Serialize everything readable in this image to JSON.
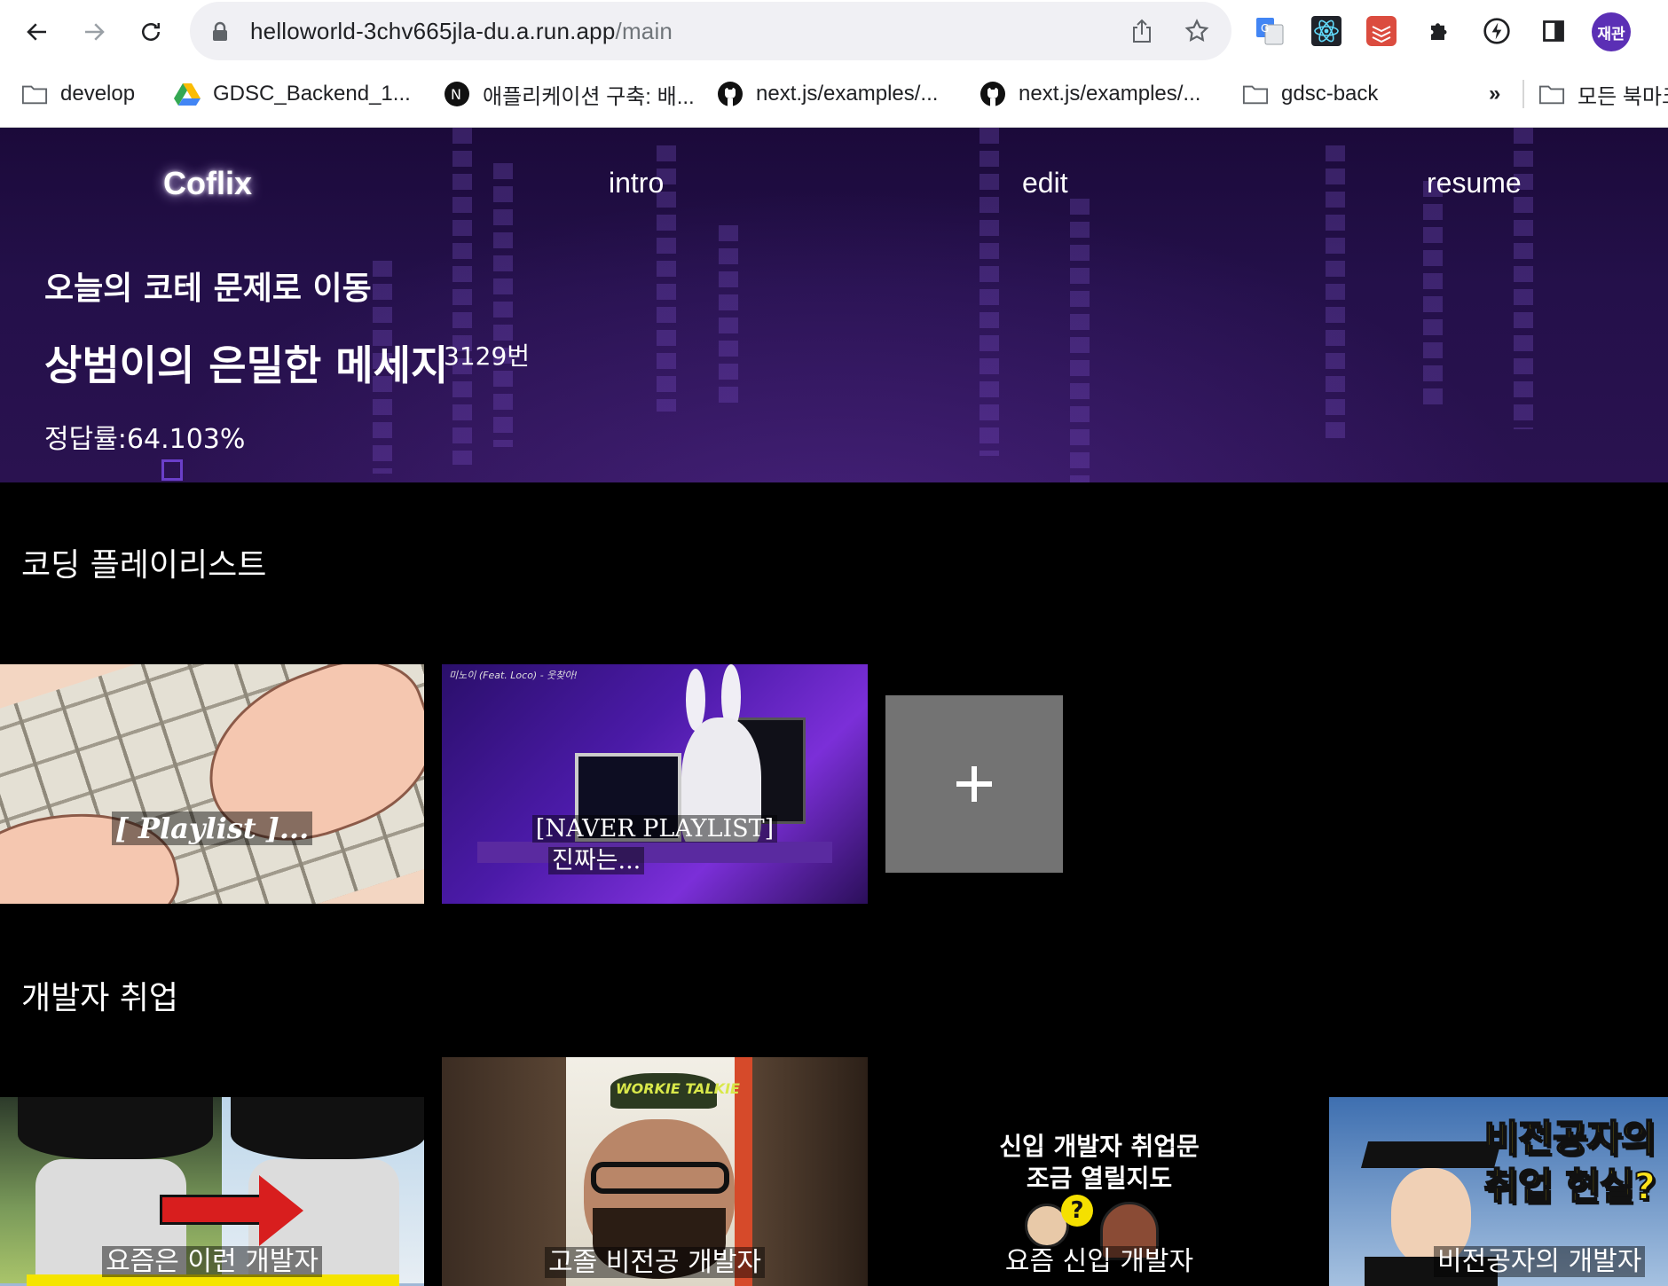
{
  "browser": {
    "url_host": "helloworld-3chv665jla-du.a.run.app",
    "url_path": "/main",
    "profile_label": "재관",
    "bookmarks": [
      {
        "label": "develop",
        "icon": "folder-icon"
      },
      {
        "label": "GDSC_Backend_1...",
        "icon": "google-drive-icon"
      },
      {
        "label": "애플리케이션 구축: 배...",
        "icon": "notion-icon"
      },
      {
        "label": "next.js/examples/...",
        "icon": "github-icon"
      },
      {
        "label": "next.js/examples/...",
        "icon": "github-icon"
      },
      {
        "label": "gdsc-back",
        "icon": "folder-icon"
      }
    ],
    "bookmarks_overflow": "»",
    "other_bookmarks": "모든 북마크"
  },
  "nav": {
    "brand": "Coflix",
    "links": [
      "intro",
      "edit",
      "resume"
    ]
  },
  "hero": {
    "move_link": "오늘의 코테 문제로 이동",
    "problem_title": "상범이의 은밀한 메세지",
    "problem_number": "3129번",
    "accuracy_label": "정답률:",
    "accuracy_value": "64.103%",
    "accent_color": "#24104a"
  },
  "sections": [
    {
      "title": "코딩 플레이리스트",
      "cards": [
        {
          "caption": "[ Playlist ]..."
        },
        {
          "caption_line1": "[NAVER PLAYLIST]",
          "caption_line2": "진짜는...",
          "top_label": "미노이 (Feat. Loco) - 웃찾아!"
        }
      ],
      "add_button": "+"
    },
    {
      "title": "개발자 취업",
      "cards": [
        {
          "caption": "요즘은 이런 개발자"
        },
        {
          "caption": "고졸 비전공 개발자",
          "hat_text": "WORKIE TALKIE"
        },
        {
          "caption": "요즘 신입 개발자",
          "headline_line1": "신입 개발자 취업문",
          "headline_line2": "조금 열릴지도",
          "badge": "?"
        },
        {
          "caption": "비전공자의 개발자",
          "headline_line1": "비전공자의",
          "headline_line2": "취업 현실?"
        }
      ]
    }
  ]
}
